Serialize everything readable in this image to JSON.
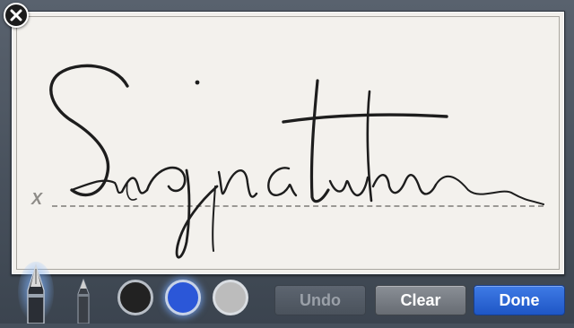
{
  "signature_pad": {
    "line_marker": "X",
    "signature_art": "Signature"
  },
  "tools": [
    {
      "name": "fountain-pen",
      "selected": true
    },
    {
      "name": "felt-pen",
      "selected": false
    }
  ],
  "colors": [
    {
      "name": "black",
      "hex": "#222222",
      "selected": false
    },
    {
      "name": "blue",
      "hex": "#2b57d8",
      "selected": true
    },
    {
      "name": "gray",
      "hex": "#bcbcbc",
      "selected": false
    }
  ],
  "buttons": {
    "undo": "Undo",
    "clear": "Clear",
    "done": "Done"
  },
  "icons": {
    "close": "close-icon"
  }
}
